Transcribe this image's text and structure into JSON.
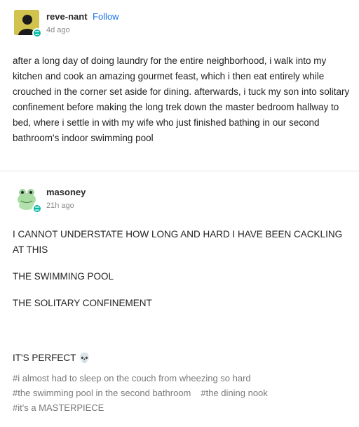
{
  "post1": {
    "username": "reve-nant",
    "follow_label": "Follow",
    "time": "4d ago",
    "text": "after a long day of doing laundry for the entire neighborhood, i walk into my kitchen and cook an amazing gourmet feast, which i then eat entirely while crouched in the corner set aside for dining. afterwards, i tuck my son into solitary confinement before making the long trek down the master bedroom hallway to bed, where i settle in with my wife who just finished bathing in our second bathroom's indoor swimming pool"
  },
  "post2": {
    "username": "masoney",
    "time": "21h ago",
    "paragraphs": [
      "I CANNOT UNDERSTATE HOW LONG AND HARD I HAVE BEEN CACKLING AT THIS",
      "THE SWIMMING POOL",
      "THE SOLITARY CONFINEMENT",
      "IT'S PERFECT"
    ],
    "emoji": "💀",
    "tags": [
      "#i almost had to sleep on the couch from wheezing so hard",
      "#the swimming pool in the second bathroom",
      "#the dining nook",
      "#it's a MASTERPIECE"
    ]
  },
  "colors": {
    "follow": "#1a73e8",
    "badge": "#00b8a0",
    "muted": "#8a8a8a"
  }
}
